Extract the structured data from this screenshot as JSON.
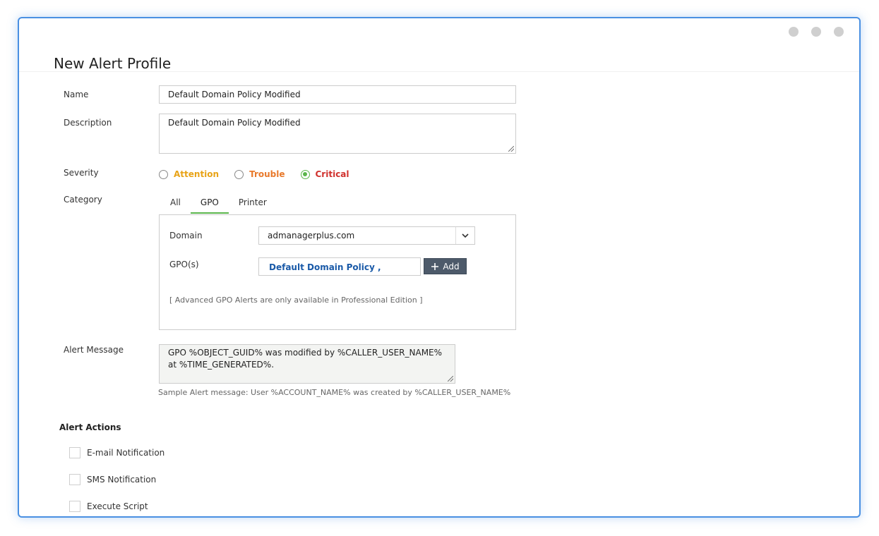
{
  "page": {
    "title": "New Alert Profile"
  },
  "form": {
    "name_label": "Name",
    "name_value": "Default Domain Policy Modified",
    "description_label": "Description",
    "description_value": "Default Domain Policy Modified",
    "severity_label": "Severity",
    "severity_options": [
      {
        "label": "Attention",
        "color": "#e8a317",
        "checked": false
      },
      {
        "label": "Trouble",
        "color": "#e8792b",
        "checked": false
      },
      {
        "label": "Critical",
        "color": "#d0312d",
        "checked": true
      }
    ],
    "category_label": "Category",
    "category_tabs": [
      {
        "label": "All",
        "active": false
      },
      {
        "label": "GPO",
        "active": true
      },
      {
        "label": "Printer",
        "active": false
      }
    ],
    "domain_label": "Domain",
    "domain_value": "admanagerplus.com",
    "gpos_label": "GPO(s)",
    "gpo_selected": "Default Domain Policy ,",
    "add_button": "Add",
    "gpo_note": "[ Advanced GPO Alerts are only available in Professional Edition ]",
    "alert_message_label": "Alert Message",
    "alert_message_value": "GPO %OBJECT_GUID% was modified by %CALLER_USER_NAME% at %TIME_GENERATED%.",
    "sample_message": "Sample Alert message: User %ACCOUNT_NAME% was created by %CALLER_USER_NAME%"
  },
  "alert_actions": {
    "title": "Alert Actions",
    "items": [
      {
        "label": "E-mail Notification",
        "checked": false
      },
      {
        "label": "SMS Notification",
        "checked": false
      },
      {
        "label": "Execute Script",
        "checked": false
      }
    ]
  },
  "colors": {
    "accent_green": "#5ab54b",
    "window_border": "#4a90e2",
    "add_button_bg": "#4d5a6a",
    "gpo_link": "#1a5aa8"
  },
  "icons": {
    "window_controls": [
      "window-dot-icon",
      "window-dot-icon",
      "window-dot-icon"
    ],
    "domain_select": "chevron-down-icon",
    "add": "plus-icon"
  }
}
